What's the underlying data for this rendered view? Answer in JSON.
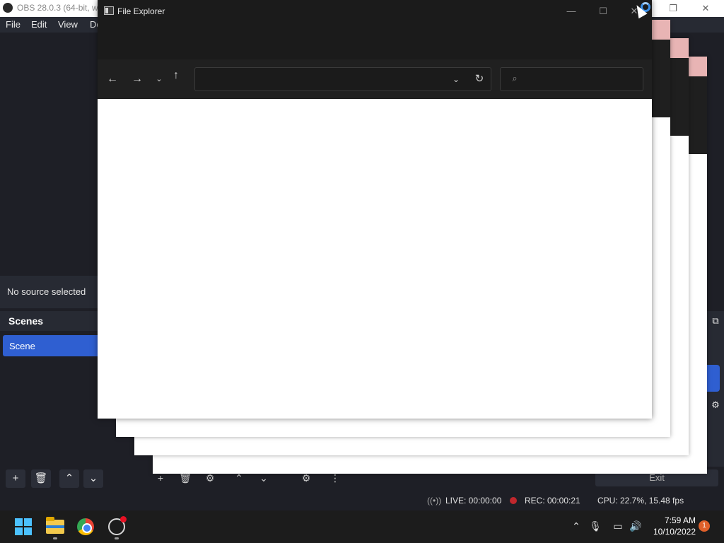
{
  "obs": {
    "window_title": "OBS 28.0.3 (64-bit, win",
    "menu": [
      "File",
      "Edit",
      "View",
      "Do"
    ],
    "source_status": "No source selected",
    "scenes_title": "Scenes",
    "scenes": [
      "Scene"
    ],
    "exit_label": "Exit",
    "status": {
      "live": "LIVE: 00:00:00",
      "rec": "REC: 00:00:21",
      "cpu": "CPU: 22.7%, 15.48 fps"
    },
    "scene_toolbar_icons": [
      "plus-icon",
      "trash-icon",
      "chevron-up-icon",
      "chevron-down-icon"
    ],
    "source_toolbar_icons": [
      "plus-icon",
      "trash-icon",
      "gear-icon",
      "chevron-up-icon",
      "chevron-down-icon",
      "filter-icon",
      "more-icon"
    ]
  },
  "file_explorer": {
    "title": "File Explorer",
    "address_value": "",
    "search_placeholder": ""
  },
  "taskbar": {
    "apps": [
      "windows-start-icon",
      "file-explorer-icon",
      "chrome-icon",
      "obs-icon"
    ],
    "tray_icons": [
      "chevron-up-icon",
      "microphone-icon",
      "network-icon",
      "volume-icon"
    ],
    "time": "7:59 AM",
    "date": "10/10/2022",
    "notification_count": "1"
  },
  "colors": {
    "obs_bg": "#1e1f26",
    "obs_accent": "#2f5fd1",
    "explorer_chrome": "#202020",
    "rec_dot": "#c1272d"
  }
}
